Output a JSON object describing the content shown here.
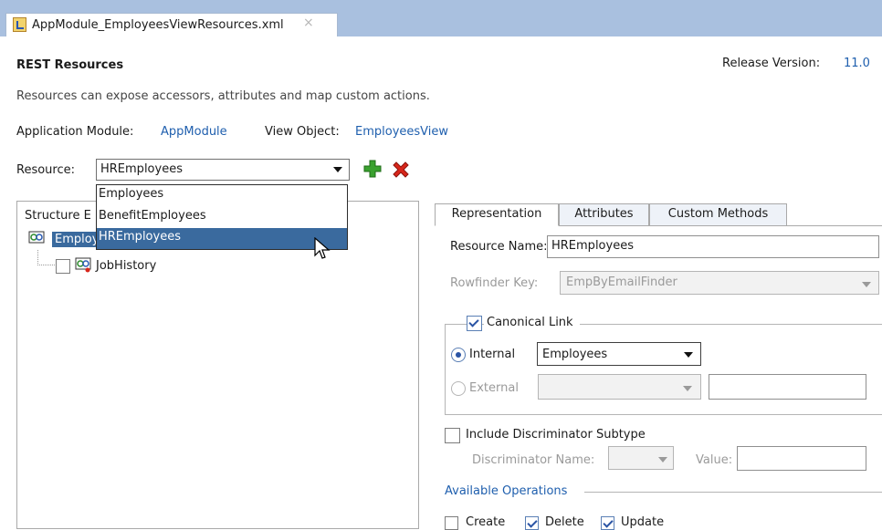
{
  "document_tab": {
    "title": "AppModule_EmployeesViewResources.xml",
    "close": "×"
  },
  "header": {
    "title": "REST Resources",
    "release_label": "Release Version:",
    "release_value": "11.0",
    "description": "Resources can expose accessors, attributes and map custom actions.",
    "app_module_label": "Application Module:",
    "app_module_value": "AppModule",
    "view_object_label": "View Object:",
    "view_object_value": "EmployeesView"
  },
  "resource": {
    "label": "Resource:",
    "selected": "HREmployees",
    "options": [
      "Employees",
      "BenefitEmployees",
      "HREmployees"
    ],
    "add_icon": "green-plus-icon",
    "delete_icon": "red-x-icon"
  },
  "structure": {
    "header": "Structure E",
    "root": "Employ",
    "child": "JobHistory"
  },
  "tabs": {
    "representation": "Representation",
    "attributes": "Attributes",
    "custom_methods": "Custom Methods"
  },
  "representation": {
    "resource_name_label": "Resource Name:",
    "resource_name_value": "HREmployees",
    "rowfinder_label": "Rowfinder Key:",
    "rowfinder_value": "EmpByEmailFinder",
    "canonical_label": "Canonical Link",
    "canonical_checked": true,
    "internal_label": "Internal",
    "internal_value": "Employees",
    "external_label": "External",
    "discriminator_label": "Include Discriminator Subtype",
    "discriminator_name_label": "Discriminator Name:",
    "value_label": "Value:",
    "operations_label": "Available Operations",
    "operations": [
      {
        "label": "Create",
        "checked": false
      },
      {
        "label": "Delete",
        "checked": true
      },
      {
        "label": "Update",
        "checked": true
      }
    ]
  }
}
